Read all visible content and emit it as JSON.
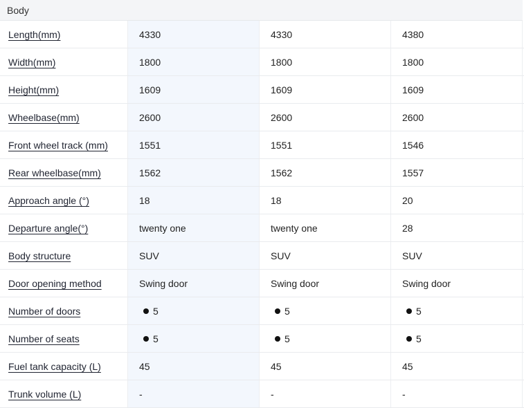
{
  "section": {
    "title": "Body"
  },
  "rows": [
    {
      "label": "Length(mm)",
      "values": [
        "4330",
        "4330",
        "4380"
      ],
      "bullet": false
    },
    {
      "label": "Width(mm)",
      "values": [
        "1800",
        "1800",
        "1800"
      ],
      "bullet": false
    },
    {
      "label": "Height(mm)",
      "values": [
        "1609",
        "1609",
        "1609"
      ],
      "bullet": false
    },
    {
      "label": "Wheelbase(mm)",
      "values": [
        "2600",
        "2600",
        "2600"
      ],
      "bullet": false
    },
    {
      "label": "Front wheel track (mm)",
      "values": [
        "1551",
        "1551",
        "1546"
      ],
      "bullet": false
    },
    {
      "label": "Rear wheelbase(mm)",
      "values": [
        "1562",
        "1562",
        "1557"
      ],
      "bullet": false
    },
    {
      "label": "Approach angle (°)",
      "values": [
        "18",
        "18",
        "20"
      ],
      "bullet": false
    },
    {
      "label": "Departure angle(°)",
      "values": [
        "twenty one",
        "twenty one",
        "28"
      ],
      "bullet": false
    },
    {
      "label": "Body structure",
      "values": [
        "SUV",
        "SUV",
        "SUV"
      ],
      "bullet": false
    },
    {
      "label": "Door opening method",
      "values": [
        "Swing door",
        "Swing door",
        "Swing door"
      ],
      "bullet": false
    },
    {
      "label": "Number of doors",
      "values": [
        "5",
        "5",
        "5"
      ],
      "bullet": true
    },
    {
      "label": "Number of seats",
      "values": [
        "5",
        "5",
        "5"
      ],
      "bullet": true
    },
    {
      "label": "Fuel tank capacity (L)",
      "values": [
        "45",
        "45",
        "45"
      ],
      "bullet": false
    },
    {
      "label": "Trunk volume (L)",
      "values": [
        "-",
        "-",
        "-"
      ],
      "bullet": false
    }
  ]
}
